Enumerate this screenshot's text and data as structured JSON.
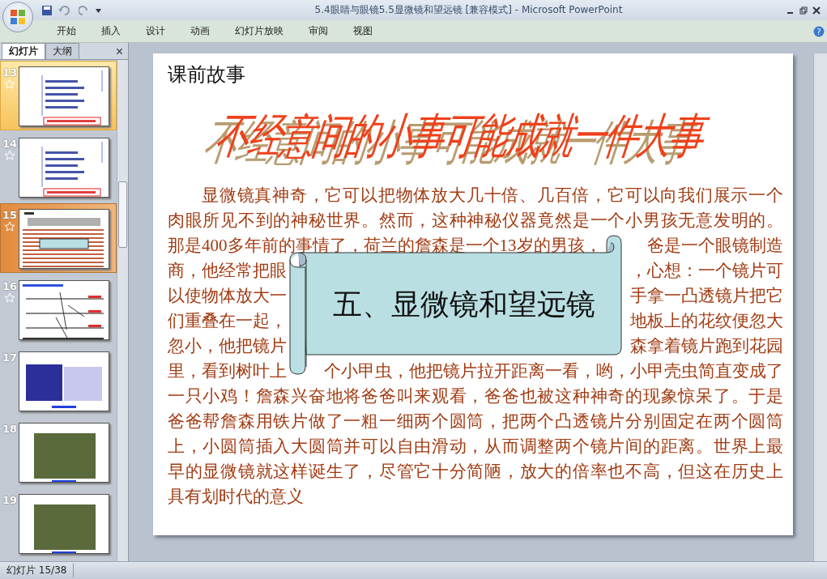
{
  "window": {
    "title": "5.4眼睛与眼镜5.5显微镜和望远镜 [兼容模式] - Microsoft PowerPoint"
  },
  "ribbon_tabs": [
    {
      "label": "开始",
      "selected": false
    },
    {
      "label": "插入",
      "selected": false
    },
    {
      "label": "设计",
      "selected": false
    },
    {
      "label": "动画",
      "selected": false
    },
    {
      "label": "幻灯片放映",
      "selected": false
    },
    {
      "label": "审阅",
      "selected": false
    },
    {
      "label": "视图",
      "selected": false
    }
  ],
  "help": "?",
  "panel_tabs": [
    {
      "label": "幻灯片",
      "selected": true
    },
    {
      "label": "大纲",
      "selected": false
    }
  ],
  "panel_close": "×",
  "thumbnails": [
    {
      "number": "13",
      "selected": false,
      "hovered": true,
      "animated": true,
      "kind": "text"
    },
    {
      "number": "14",
      "selected": false,
      "hovered": false,
      "animated": true,
      "kind": "text"
    },
    {
      "number": "15",
      "selected": true,
      "hovered": false,
      "animated": true,
      "kind": "story"
    },
    {
      "number": "16",
      "selected": false,
      "hovered": false,
      "animated": true,
      "kind": "diagram"
    },
    {
      "number": "17",
      "selected": false,
      "hovered": false,
      "animated": false,
      "kind": "photos"
    },
    {
      "number": "18",
      "selected": false,
      "hovered": false,
      "animated": false,
      "kind": "photo"
    },
    {
      "number": "19",
      "selected": false,
      "hovered": false,
      "animated": false,
      "kind": "photo"
    }
  ],
  "slide": {
    "heading": "课前故事",
    "wordart": "不经意间的小事可能成就一件大事",
    "body_lines": [
      [
        "显微镜真神奇，它可以把物体放大几十倍、几百倍，它可以向我们展示一个"
      ],
      [
        "肉眼所见不到的神秘世界。然而，这种神秘仪器竟然是一个小男孩无意发明的。"
      ],
      [
        "那是400多年前的事情了，荷兰的詹森是一个13岁的男孩，",
        "爸是一个眼镜制造"
      ],
      [
        "商，他经常把眼",
        "，心想：一个镜片可"
      ],
      [
        "以使物体放大一",
        "手拿一凸透镜片把它"
      ],
      [
        "们重叠在一起，",
        "地板上的花纹便忽大"
      ],
      [
        "忽小，他把镜片",
        "森拿着镜片跑到花园"
      ],
      [
        "里，看到树叶上",
        "个小甲虫，他把镜片拉开距离一看，哟，小甲壳虫简直变成了"
      ],
      [
        "一只小鸡！詹森兴奋地将爸爸叫来观看，爸爸也被这种神奇的现象惊呆了。于是"
      ],
      [
        "爸爸帮詹森用铁片做了一粗一细两个圆筒，把两个凸透镜片分别固定在两个圆筒"
      ],
      [
        "上，小圆筒插入大圆筒并可以自由滑动，从而调整两个镜片间的距离。世界上最"
      ],
      [
        "早的显微镜就这样诞生了，尽管它十分简陋，放大的倍率也不高，但这在历史上"
      ],
      [
        "具有划时代的意义"
      ]
    ],
    "scroll_title": "五、显微镜和望远镜"
  },
  "status_bar": {
    "slide_counter": "幻灯片 15/38"
  }
}
